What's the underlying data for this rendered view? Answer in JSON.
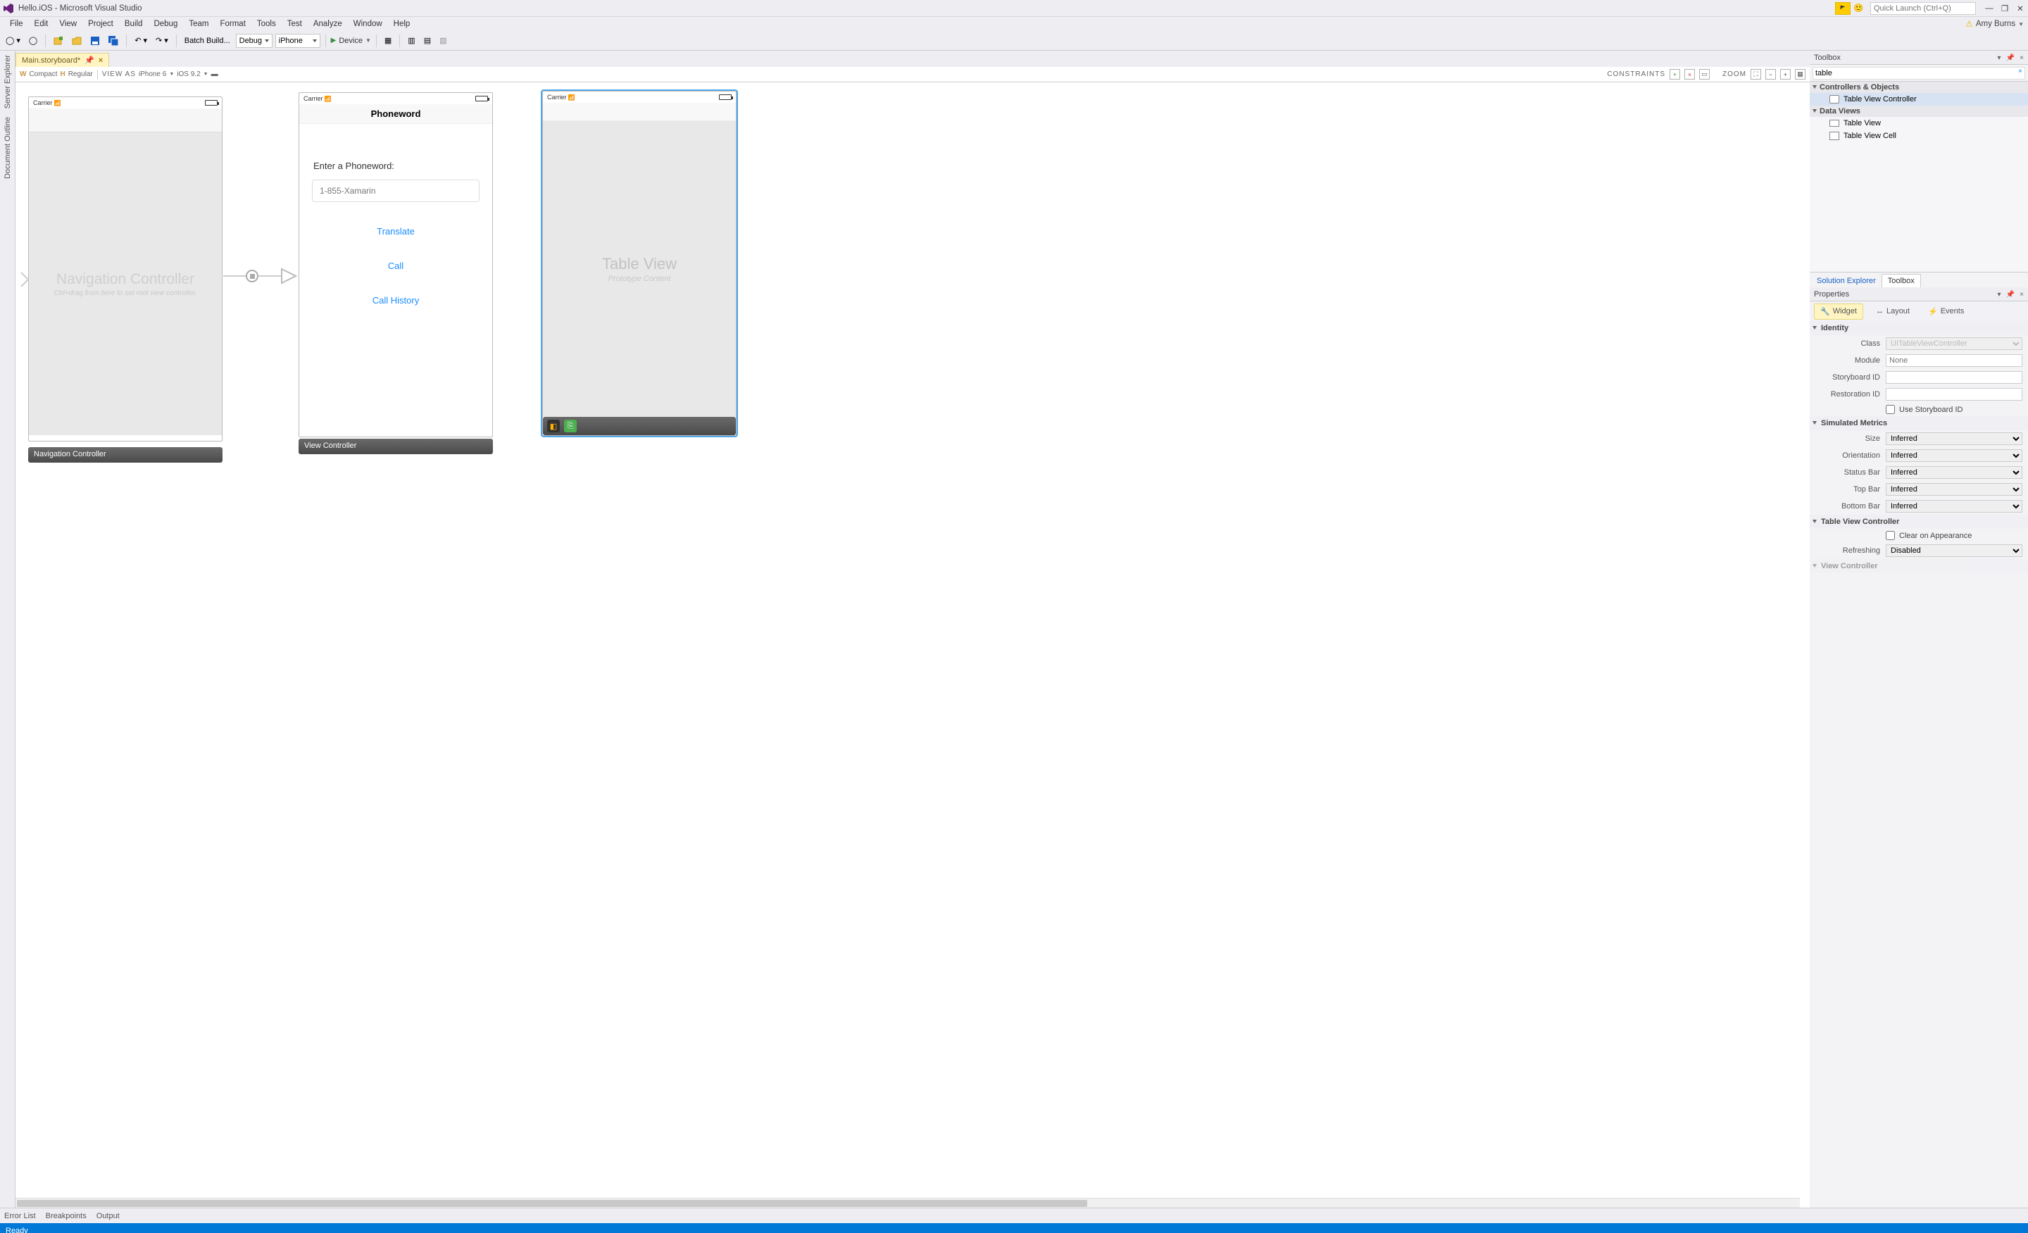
{
  "titlebar": {
    "title": "Hello.iOS - Microsoft Visual Studio",
    "quick_launch_placeholder": "Quick Launch (Ctrl+Q)"
  },
  "menu": {
    "items": [
      "File",
      "Edit",
      "View",
      "Project",
      "Build",
      "Debug",
      "Team",
      "Format",
      "Tools",
      "Test",
      "Analyze",
      "Window",
      "Help"
    ],
    "user": "Amy Burns"
  },
  "toolbar": {
    "batch_build": "Batch Build...",
    "config": "Debug",
    "platform": "iPhone",
    "device": "Device"
  },
  "doc_tab": {
    "name": "Main.storyboard*"
  },
  "designer_bar": {
    "size_class_w": "W",
    "size_class_wval": "Compact",
    "size_class_h": "H",
    "size_class_hval": "Regular",
    "view_as_label": "VIEW AS",
    "view_as_device": "iPhone 6",
    "view_as_os": "iOS 9.2",
    "constraints_label": "CONSTRAINTS",
    "zoom_label": "ZOOM"
  },
  "scenes": {
    "nav": {
      "label": "Navigation Controller",
      "carrier": "Carrier",
      "big_title": "Navigation Controller",
      "hint": "Ctrl+drag from here to set root view controller."
    },
    "vc": {
      "label": "View Controller",
      "carrier": "Carrier",
      "title": "Phoneword",
      "prompt": "Enter a Phoneword:",
      "value": "1-855-Xamarin",
      "btn_translate": "Translate",
      "btn_call": "Call",
      "btn_history": "Call History"
    },
    "tvc": {
      "carrier": "Carrier",
      "big_title": "Table View",
      "subtitle": "Prototype Content"
    }
  },
  "left_rail": {
    "tab1": "Server Explorer",
    "tab2": "Document Outline"
  },
  "toolbox": {
    "title": "Toolbox",
    "search_value": "table",
    "groups": [
      {
        "name": "Controllers & Objects",
        "items": [
          {
            "label": "Table View Controller",
            "selected": true
          }
        ]
      },
      {
        "name": "Data Views",
        "items": [
          {
            "label": "Table View"
          },
          {
            "label": "Table View Cell"
          }
        ]
      }
    ]
  },
  "right_tabs": {
    "solution": "Solution Explorer",
    "toolbox": "Toolbox"
  },
  "properties": {
    "title": "Properties",
    "tabs": {
      "widget": "Widget",
      "layout": "Layout",
      "events": "Events"
    },
    "identity": {
      "header": "Identity",
      "class_label": "Class",
      "class_ph": "UITableViewController",
      "module_label": "Module",
      "module_ph": "None",
      "sbid_label": "Storyboard ID",
      "restid_label": "Restoration ID",
      "use_sbid": "Use Storyboard ID"
    },
    "simulated": {
      "header": "Simulated Metrics",
      "size_label": "Size",
      "size_val": "Inferred",
      "orient_label": "Orientation",
      "orient_val": "Inferred",
      "status_label": "Status Bar",
      "status_val": "Inferred",
      "top_label": "Top Bar",
      "top_val": "Inferred",
      "bottom_label": "Bottom Bar",
      "bottom_val": "Inferred"
    },
    "tvc": {
      "header": "Table View Controller",
      "clear_label": "Clear on Appearance",
      "refresh_label": "Refreshing",
      "refresh_val": "Disabled"
    },
    "next_section": "View Controller"
  },
  "bottom_tabs": {
    "errors": "Error List",
    "breakpoints": "Breakpoints",
    "output": "Output"
  },
  "status": {
    "ready": "Ready"
  }
}
